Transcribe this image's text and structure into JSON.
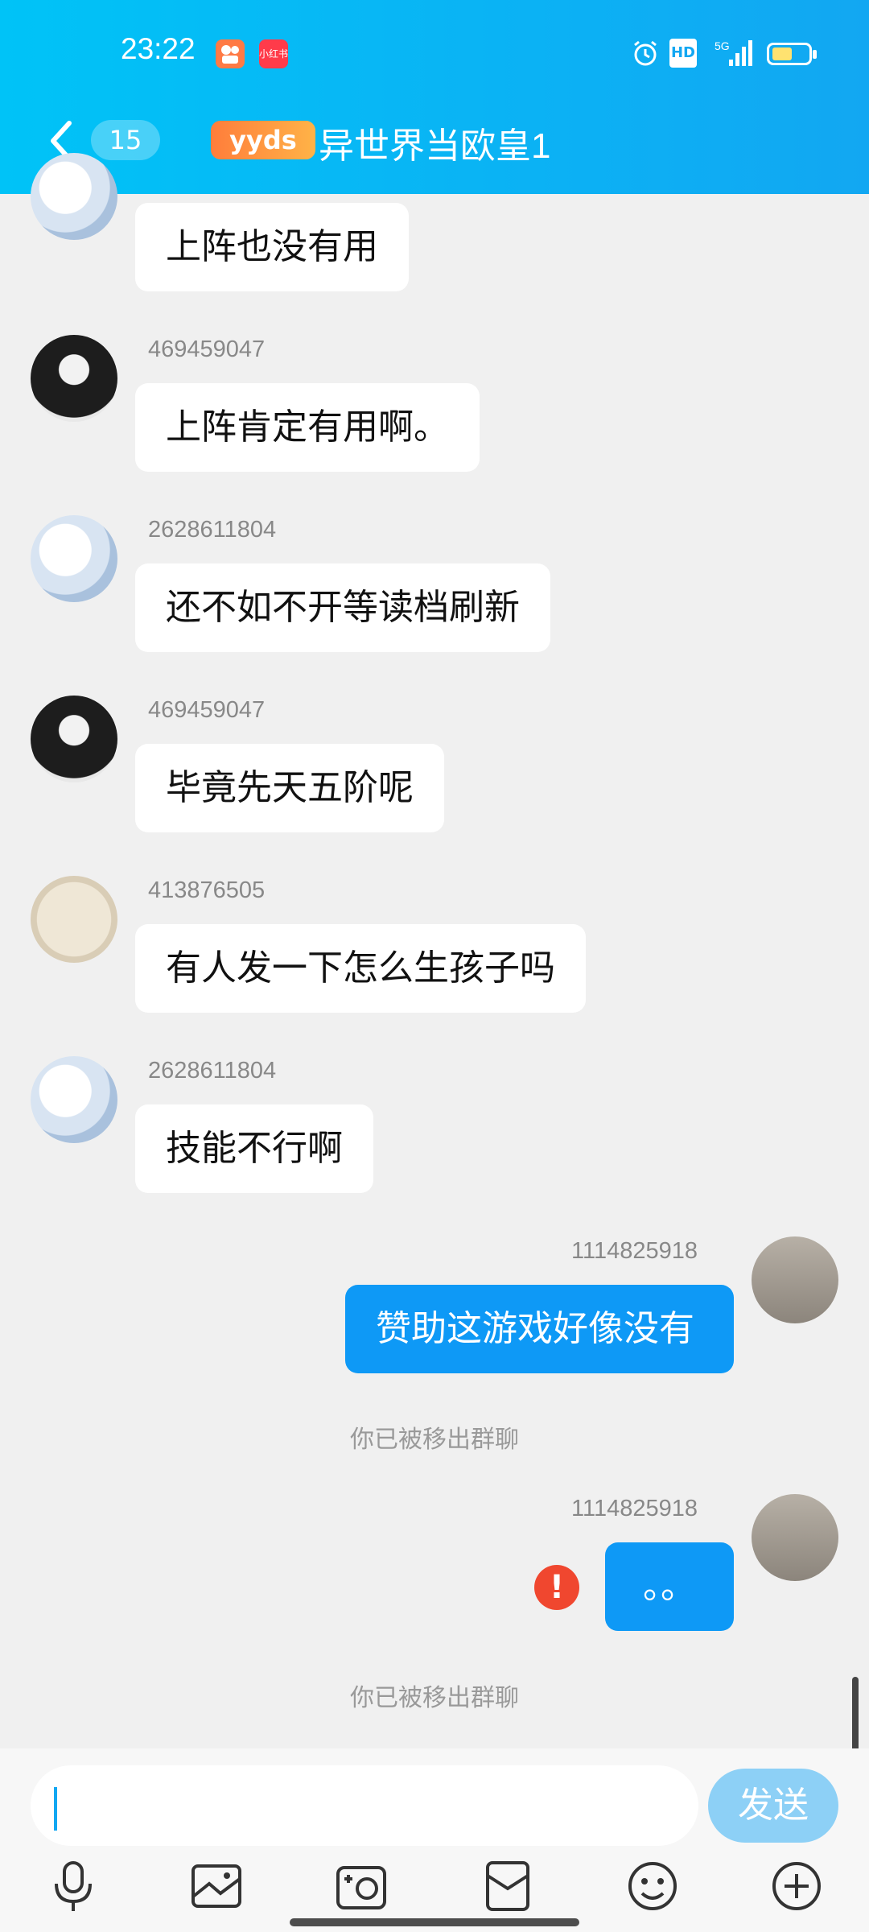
{
  "status_bar": {
    "time": "23:22",
    "app_icon_1": "",
    "app_icon_2": "小红书",
    "hd": "HD",
    "network": "5G"
  },
  "header": {
    "unread_count": "15",
    "badge_text": "yyds",
    "title": "异世界当欧皇1"
  },
  "messages": [
    {
      "sender": "",
      "text": "上阵也没有用"
    },
    {
      "sender": "469459047",
      "text": "上阵肯定有用啊。"
    },
    {
      "sender": "2628611804",
      "text": "还不如不开等读档刷新"
    },
    {
      "sender": "469459047",
      "text": "毕竟先天五阶呢"
    },
    {
      "sender": "413876505",
      "text": "有人发一下怎么生孩子吗"
    },
    {
      "sender": "2628611804",
      "text": "技能不行啊"
    },
    {
      "sender": "1114825918",
      "text": "赞助这游戏好像没有"
    },
    {
      "sender": "1114825918",
      "text": "。。"
    }
  ],
  "notices": [
    "你已被移出群聊",
    "你已被移出群聊"
  ],
  "error_mark": "!",
  "input": {
    "value": "",
    "send_label": "发送"
  },
  "toolbar_icons": [
    "microphone-icon",
    "image-icon",
    "camera-icon",
    "red-packet-icon",
    "emoji-icon",
    "plus-icon"
  ],
  "colors": {
    "header": "#12a7f2",
    "my_bubble": "#0e99f6",
    "send_button": "#8dd0f6",
    "error": "#f0472f"
  }
}
